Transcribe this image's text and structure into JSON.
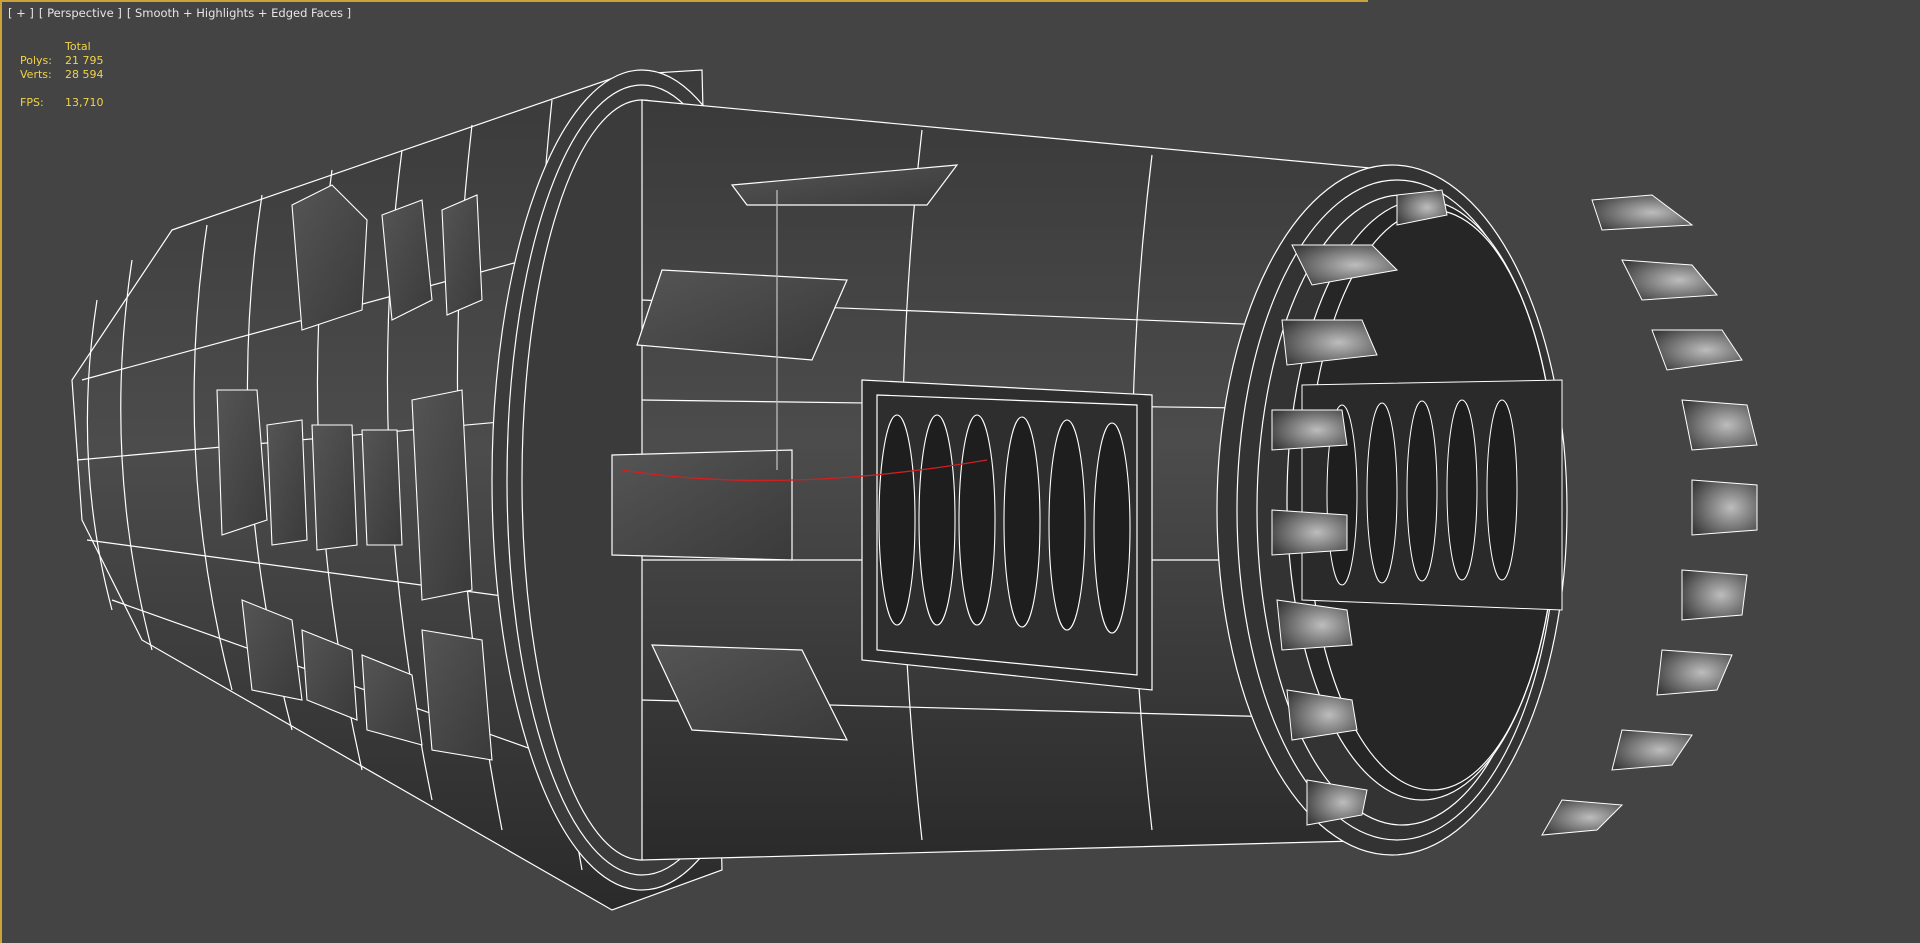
{
  "viewport": {
    "menu_plus": "[ + ]",
    "view_name": "[ Perspective ]",
    "shading_mode": "[ Smooth + Highlights + Edged Faces ]",
    "border_color": "#c9a23a",
    "background_color": "#444444"
  },
  "stats": {
    "header": "Total",
    "polys_label": "Polys:",
    "polys_value": "21 795",
    "verts_label": "Verts:",
    "verts_value": "28 594",
    "fps_label": "FPS:",
    "fps_value": "13,710",
    "text_color": "#f0d34a"
  },
  "scene": {
    "object": "cylindrical-engine-model",
    "wire_color": "#ffffff",
    "gizmo_color": "#d02020"
  }
}
